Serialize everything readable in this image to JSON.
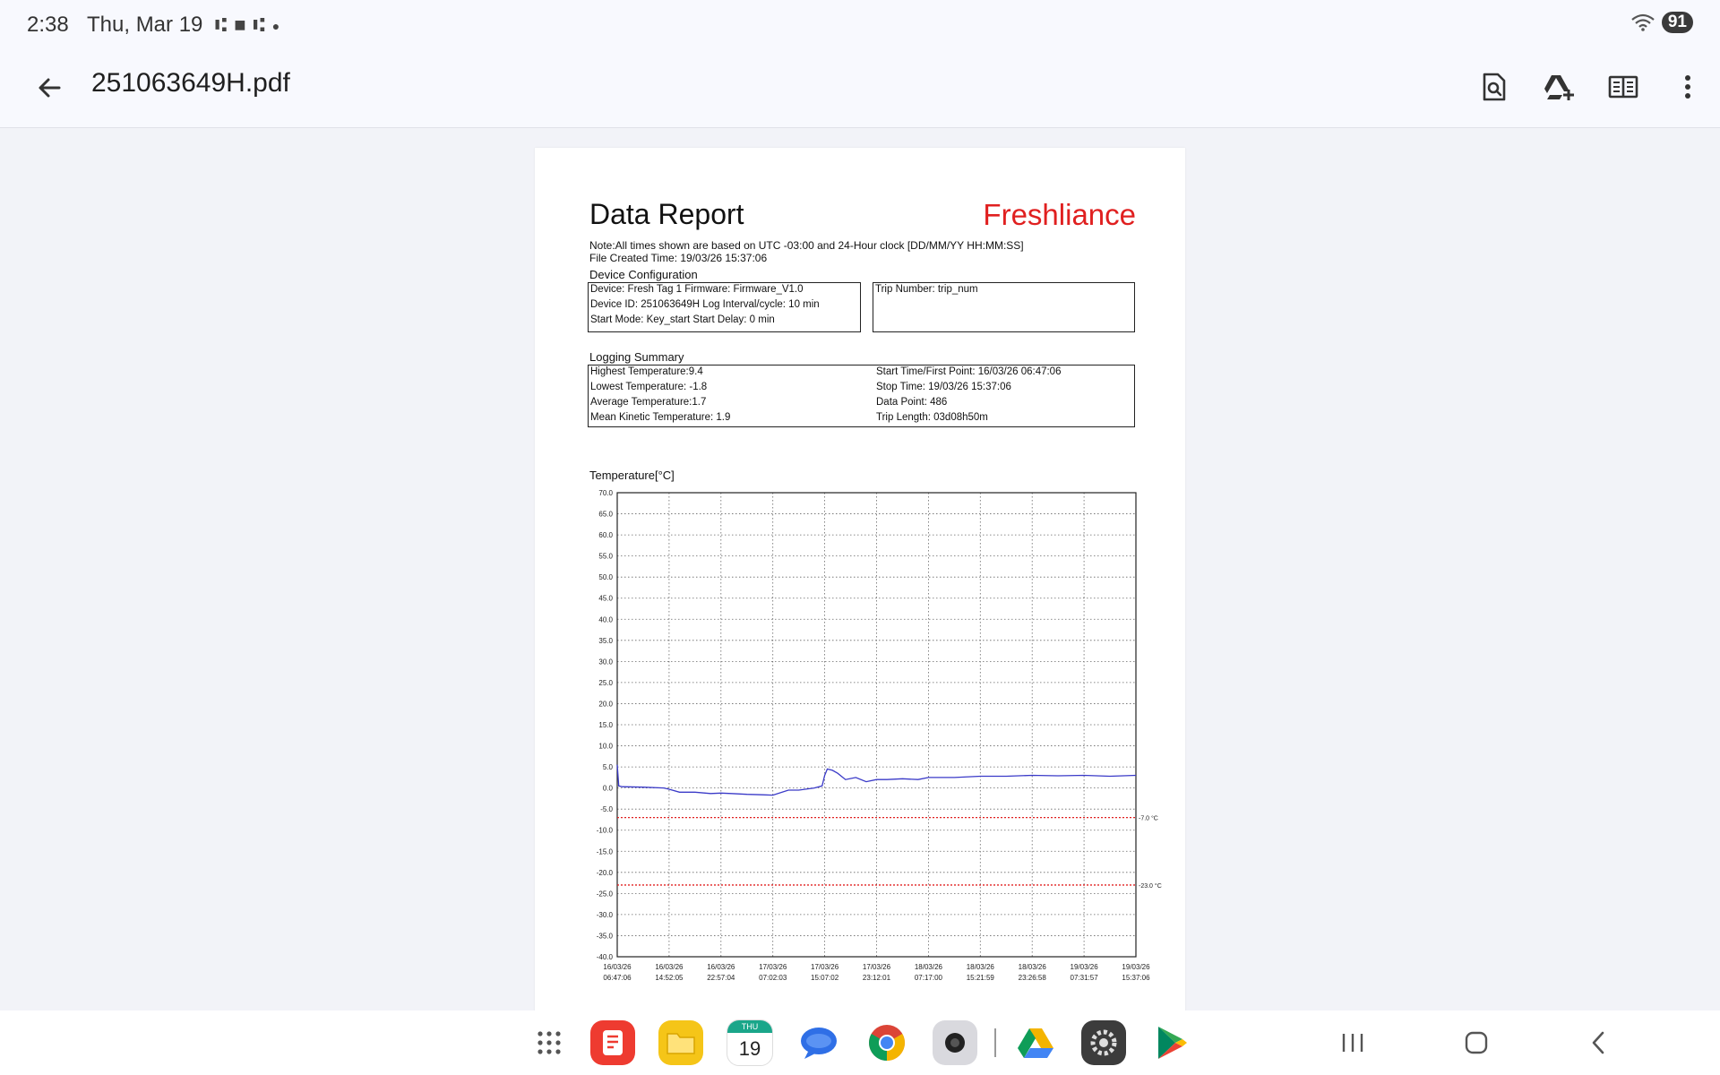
{
  "status_bar": {
    "time": "2:38",
    "date": "Thu, Mar 19",
    "notification_icons": [
      "usb-icon",
      "video-camera-icon",
      "usb-icon",
      "dot-icon"
    ],
    "wifi_label": "5",
    "battery": "91"
  },
  "app_bar": {
    "title": "251063649H.pdf",
    "actions": [
      "find-in-document-icon",
      "add-to-drive-icon",
      "reading-mode-icon",
      "more-options-icon"
    ]
  },
  "report": {
    "title": "Data Report",
    "brand": "Freshliance",
    "note": "Note:All times shown are based on UTC -03:00   and 24-Hour clock   [DD/MM/YY HH:MM:SS]",
    "file_created": "File Created Time: 19/03/26 15:37:06",
    "device_config_title": "Device Configuration",
    "device_lines": [
      "Device:  Fresh Tag 1      Firmware: Firmware_V1.0",
      "Device ID: 251063649H Log Interval/cycle: 10 min",
      "Start Mode: Key_start    Start Delay:  0 min"
    ],
    "trip_number": "Trip Number: trip_num",
    "logging_summary_title": "Logging Summary",
    "summary_left": [
      "Highest Temperature:9.4",
      "Lowest Temperature: -1.8",
      "Average Temperature:1.7",
      "Mean Kinetic Temperature: 1.9"
    ],
    "summary_right": [
      "Start Time/First Point: 16/03/26 06:47:06",
      "Stop Time: 19/03/26 15:37:06",
      "Data Point:  486",
      "Trip Length:  03d08h50m"
    ]
  },
  "chart_data": {
    "type": "line",
    "ylabel": "Temperature[°C]",
    "ylim": [
      -40,
      70
    ],
    "yticks": [
      "70.0",
      "65.0",
      "60.0",
      "55.0",
      "50.0",
      "45.0",
      "40.0",
      "35.0",
      "30.0",
      "25.0",
      "20.0",
      "15.0",
      "10.0",
      "5.0",
      "0.0",
      "-5.0",
      "-10.0",
      "-15.0",
      "-20.0",
      "-25.0",
      "-30.0",
      "-35.0",
      "-40.0"
    ],
    "xticks": [
      [
        "16/03/26",
        "06:47:06"
      ],
      [
        "16/03/26",
        "14:52:05"
      ],
      [
        "16/03/26",
        "22:57:04"
      ],
      [
        "17/03/26",
        "07:02:03"
      ],
      [
        "17/03/26",
        "15:07:02"
      ],
      [
        "17/03/26",
        "23:12:01"
      ],
      [
        "18/03/26",
        "07:17:00"
      ],
      [
        "18/03/26",
        "15:21:59"
      ],
      [
        "18/03/26",
        "23:26:58"
      ],
      [
        "19/03/26",
        "07:31:57"
      ],
      [
        "19/03/26",
        "15:37:06"
      ]
    ],
    "grid": true,
    "series": [
      {
        "color": "#3a3ac8",
        "x": [
          0,
          0.03,
          0.1,
          0.5,
          0.9,
          1.0,
          1.2,
          1.5,
          1.8,
          2.0,
          2.2,
          2.5,
          2.8,
          3.0,
          3.3,
          3.5,
          3.8,
          3.95,
          4.0,
          4.05,
          4.15,
          4.25,
          4.4,
          4.6,
          4.8,
          5.0,
          5.2,
          5.5,
          5.8,
          6.0,
          6.5,
          7.0,
          7.5,
          8.0,
          8.5,
          9.0,
          9.5,
          10.0
        ],
        "y": [
          5.5,
          0.5,
          0.3,
          0.2,
          0,
          -0.3,
          -1.0,
          -1.0,
          -1.3,
          -1.2,
          -1.3,
          -1.5,
          -1.6,
          -1.7,
          -0.5,
          -0.5,
          0.0,
          0.5,
          3.0,
          4.5,
          4.2,
          3.5,
          2.0,
          2.5,
          1.5,
          2.0,
          2.0,
          2.2,
          2.0,
          2.5,
          2.5,
          2.8,
          2.8,
          3.0,
          2.9,
          3.0,
          2.8,
          3.0
        ]
      }
    ],
    "thresholds": [
      {
        "value": -7.0,
        "label": "-7.0  °C",
        "color": "#e02020"
      },
      {
        "value": -23.0,
        "label": "-23.0 °C",
        "color": "#e02020"
      }
    ]
  },
  "dock_apps": [
    "notes-app-icon",
    "files-app-icon",
    "calendar-app-icon",
    "messages-app-icon",
    "chrome-app-icon",
    "camera-app-icon",
    "drive-app-icon",
    "settings-app-icon",
    "play-store-app-icon"
  ],
  "calendar_icon": {
    "day": "THU",
    "date": "19"
  },
  "nav_buttons": [
    "recent-apps-icon",
    "home-icon",
    "back-icon"
  ],
  "colors": {
    "brand": "#e02020",
    "series": "#3a3ac8",
    "fab": "#ecdcfb"
  }
}
